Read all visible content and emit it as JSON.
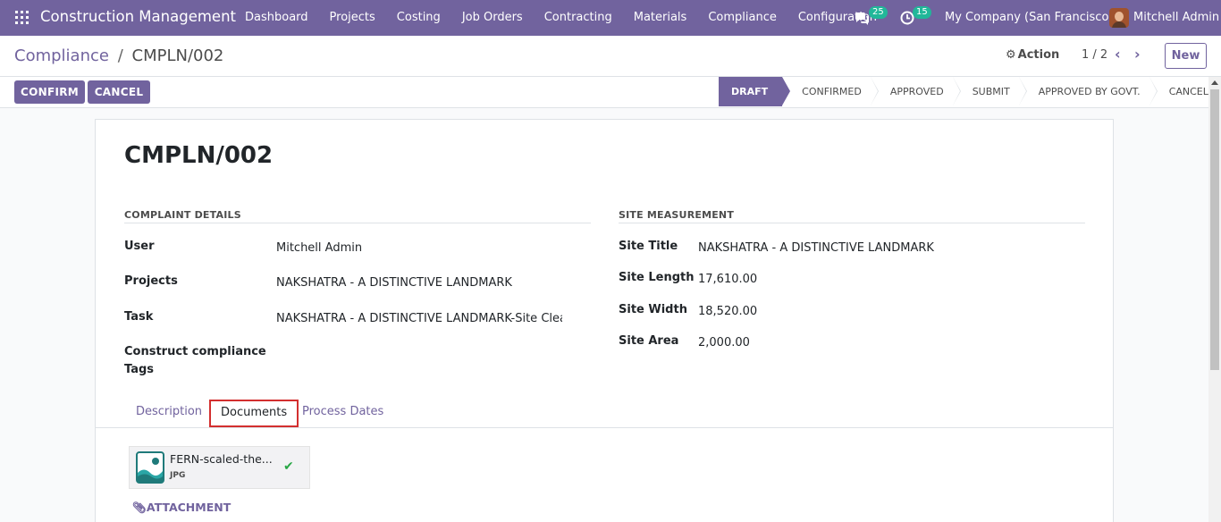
{
  "navbar": {
    "brand": "Construction Management",
    "menu": [
      "Dashboard",
      "Projects",
      "Costing",
      "Job Orders",
      "Contracting",
      "Materials",
      "Compliance",
      "Configuration"
    ],
    "messages_count": "25",
    "activities_count": "15",
    "company": "My Company (San Francisco)",
    "user": "Mitchell Admin"
  },
  "control_panel": {
    "breadcrumb_parent": "Compliance",
    "breadcrumb_separator": "/",
    "breadcrumb_current": "CMPLN/002",
    "action_label": "Action",
    "pager_value": "1 / 2",
    "new_label": "New"
  },
  "statusbar": {
    "confirm_label": "CONFIRM",
    "cancel_label": "CANCEL",
    "stages": [
      "DRAFT",
      "CONFIRMED",
      "APPROVED",
      "SUBMIT",
      "APPROVED BY GOVT.",
      "CANCEL"
    ],
    "active_stage": "DRAFT"
  },
  "form": {
    "title": "CMPLN/002",
    "complaint_details": {
      "heading": "COMPLAINT DETAILS",
      "user_label": "User",
      "user_value": "Mitchell Admin",
      "projects_label": "Projects",
      "projects_value": "NAKSHATRA - A DISTINCTIVE LANDMARK",
      "task_label": "Task",
      "task_value": "NAKSHATRA - A DISTINCTIVE LANDMARK-Site Clearing",
      "tags_label_line1": "Construct compliance",
      "tags_label_line2": "Tags"
    },
    "site_measurement": {
      "heading": "SITE MEASUREMENT",
      "site_title_label": "Site Title",
      "site_title_value": "NAKSHATRA - A DISTINCTIVE LANDMARK",
      "site_length_label": "Site Length",
      "site_length_value": "17,610.00",
      "site_width_label": "Site Width",
      "site_width_value": "18,520.00",
      "site_area_label": "Site Area",
      "site_area_value": "2,000.00"
    },
    "tabs": [
      "Description",
      "Documents",
      "Process Dates"
    ],
    "active_tab": "Documents",
    "attachment": {
      "file_name": "FERN-scaled-the...",
      "file_ext": "JPG",
      "attach_label": "ATTACHMENT"
    }
  },
  "colors": {
    "brand": "#71639e",
    "badge": "#21b799",
    "highlight": "#d32f2f",
    "success": "#28a745"
  }
}
